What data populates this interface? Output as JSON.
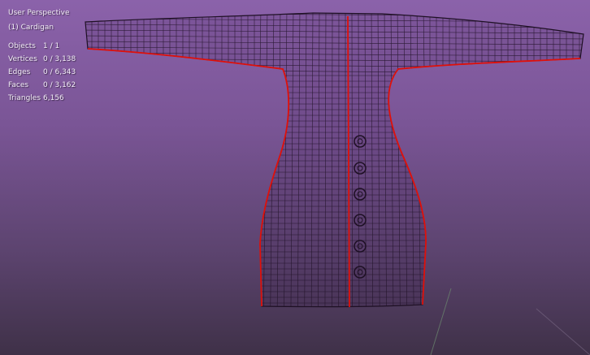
{
  "viewport": {
    "view_name": "User Perspective",
    "object_label": "(1) Cardigan",
    "stats": [
      {
        "label": "Objects",
        "value": "1 / 1"
      },
      {
        "label": "Vertices",
        "value": "0 / 3,138"
      },
      {
        "label": "Edges",
        "value": "0 / 6,343"
      },
      {
        "label": "Faces",
        "value": "0 / 3,162"
      },
      {
        "label": "Triangles",
        "value": "6,156"
      }
    ],
    "buttons_count": 6
  },
  "colors": {
    "wire": "#1e1024",
    "seam": "#e0100a",
    "grid": "#6a8a6a"
  }
}
